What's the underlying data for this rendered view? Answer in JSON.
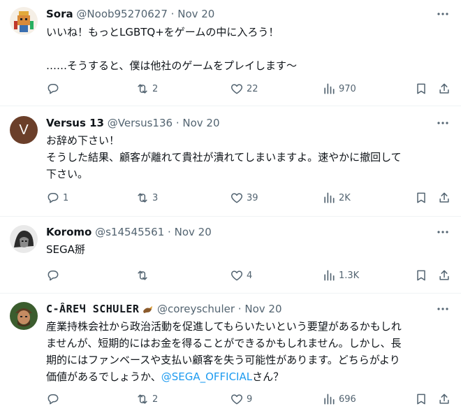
{
  "tweets": [
    {
      "name": "Sora",
      "handle": "@Noob95270627",
      "dot": "·",
      "date": "Nov 20",
      "text_line1": "いいね！もっとLGBTQ+をゲームの中に入ろう！",
      "text_line2": "……そうすると、僕は他社のゲームをプレイします〜",
      "replies": "",
      "reposts": "2",
      "likes": "22",
      "views": "970"
    },
    {
      "name": "Versus 13",
      "handle": "@Versus136",
      "dot": "·",
      "date": "Nov 20",
      "avatar_letter": "V",
      "text_line1": "お辞め下さい！",
      "text_line2": "そうした結果、顧客が離れて貴社が潰れてしまいますよ。速やかに撤回して",
      "text_line3": "下さい。",
      "replies": "1",
      "reposts": "3",
      "likes": "39",
      "views": "2K"
    },
    {
      "name": "Koromo",
      "handle": "@s14545561",
      "dot": "·",
      "date": "Nov 20",
      "text_line1": "SEGA掰",
      "replies": "",
      "reposts": "",
      "likes": "4",
      "views": "1.3K"
    },
    {
      "name": "C-ÂREЧ SCHULER",
      "handle": "@coreyschuler",
      "dot": "·",
      "date": "Nov 20",
      "text_line1": "産業持株会社から政治活動を促進してもらいたいという要望があるかもしれ",
      "text_line2": "ませんが、短期的にはお金を得ることができるかもしれません。しかし、長",
      "text_line3": "期的にはファンベースや支払い顧客を失う可能性があります。どちらがより",
      "text_line4_pre": "価値があるでしょうか、",
      "mention": "@SEGA_OFFICIAL",
      "text_line4_post": "さん？",
      "replies": "",
      "reposts": "2",
      "likes": "9",
      "views": "696"
    }
  ],
  "icons": {
    "more": "ellipsis-icon",
    "reply": "reply-bubble-icon",
    "repost": "repost-arrows-icon",
    "like": "heart-icon",
    "views": "bar-chart-icon",
    "bookmark": "bookmark-icon",
    "share": "share-upload-icon"
  },
  "colors": {
    "text": "#0f1419",
    "secondary": "#536471",
    "link": "#1d9bf0",
    "divider": "#eff3f4"
  }
}
